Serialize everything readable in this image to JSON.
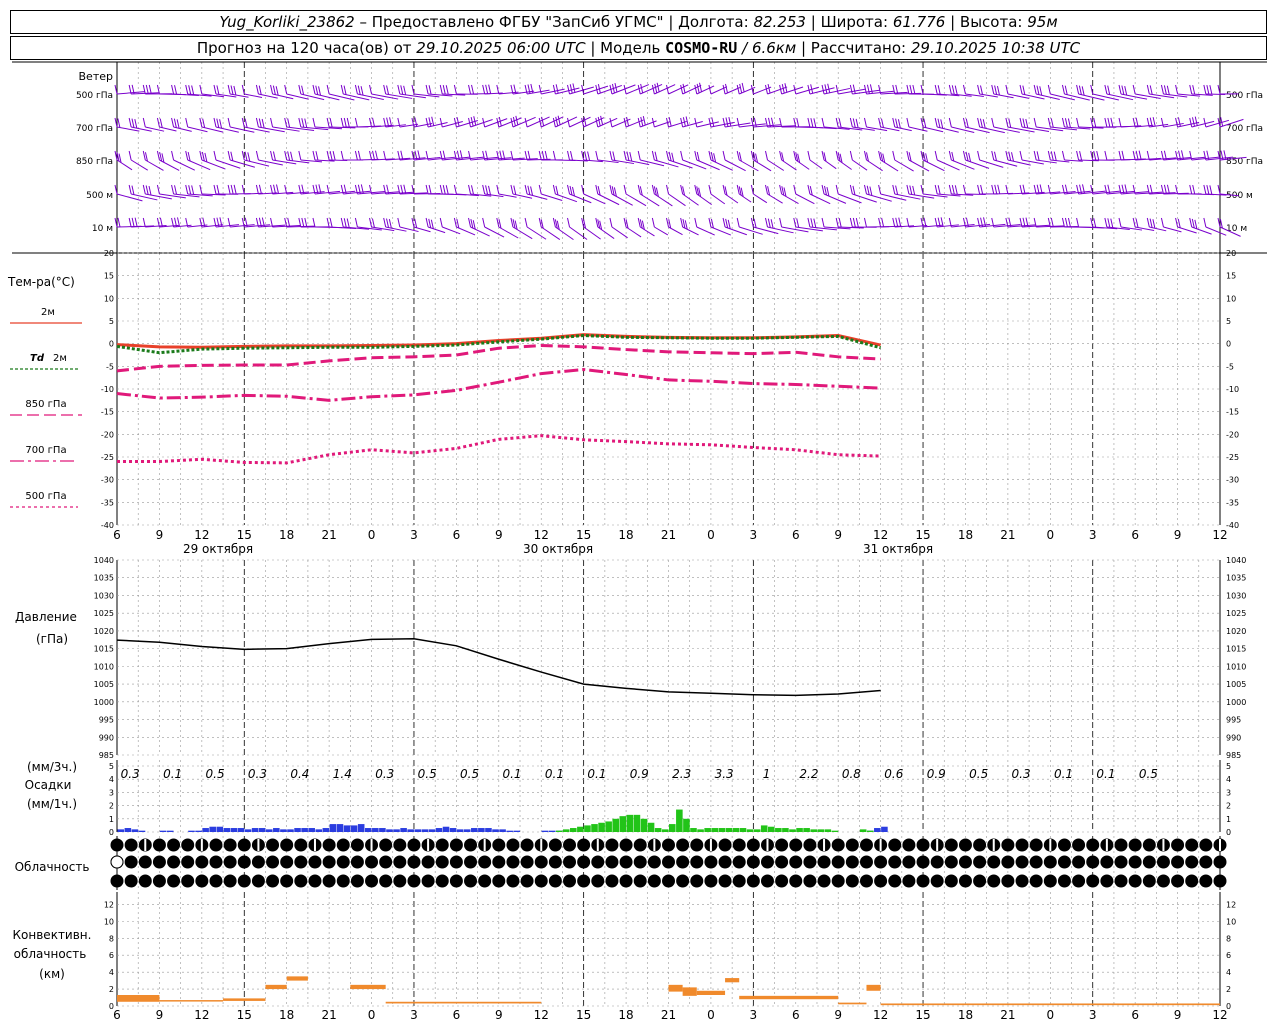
{
  "header": {
    "station": "Yug_Korliki_23862",
    "provider": "– Предоставлено ФГБУ \"ЗапСиб УГМС\"",
    "lon_label": "Долгота:",
    "lon": "82.253",
    "lat_label": "Широта:",
    "lat": "61.776",
    "alt_label": "Высота:",
    "alt": "95м",
    "forecast_label": "Прогноз на 120 часа(ов) от",
    "forecast_time": "29.10.2025 06:00 UTC",
    "model_label": "Модель",
    "model": "COSMO-RU",
    "resolution": "/ 6.6км",
    "calc_label": "Рассчитано:",
    "calc_time": "29.10.2025 10:38 UTC"
  },
  "chart_data": [
    {
      "type": "wind-barbs",
      "title": "Ветер",
      "levels": [
        "500 гПа",
        "700 гПа",
        "850 гПа",
        "500 м",
        "10 м"
      ],
      "color": "#7a00cc"
    },
    {
      "type": "line",
      "title": "Тем-ра(°C)",
      "ylim": [
        -40,
        20
      ],
      "yticks": [
        20,
        15,
        10,
        5,
        0,
        -5,
        -10,
        -15,
        -20,
        -25,
        -30,
        -35,
        -40
      ],
      "x_hours": [
        0,
        6,
        12,
        18,
        24,
        30,
        36,
        42,
        48,
        54,
        60,
        66,
        72,
        78,
        84,
        90,
        96,
        102,
        108
      ],
      "series": [
        {
          "name": "2м",
          "color": "#e8402a",
          "dash": "",
          "values": [
            -0.2,
            -0.7,
            -0.8,
            -0.6,
            -0.5,
            -0.5,
            -0.4,
            -0.3,
            0.0,
            0.7,
            1.2,
            2.0,
            1.6,
            1.4,
            1.3,
            1.3,
            1.5,
            1.8,
            -0.3
          ]
        },
        {
          "name": "Td 2м",
          "color": "#1a7a1a",
          "dash": "3,2",
          "values": [
            -0.6,
            -2.0,
            -1.2,
            -1.0,
            -0.9,
            -0.8,
            -0.8,
            -0.6,
            -0.3,
            0.4,
            1.0,
            1.8,
            1.4,
            1.3,
            1.2,
            1.2,
            1.4,
            1.6,
            -0.9
          ]
        },
        {
          "name": "850 гПа",
          "color": "#e0197a",
          "dash": "12,5",
          "values": [
            -6.0,
            -5.0,
            -4.8,
            -4.7,
            -4.7,
            -3.8,
            -3.1,
            -2.9,
            -2.5,
            -1.0,
            -0.4,
            -0.7,
            -1.3,
            -1.8,
            -2.0,
            -2.2,
            -1.9,
            -2.9,
            -3.4
          ]
        },
        {
          "name": "700 гПа",
          "color": "#e0197a",
          "dash": "14,4,3,4",
          "values": [
            -11.0,
            -12.0,
            -11.8,
            -11.4,
            -11.6,
            -12.5,
            -11.7,
            -11.3,
            -10.3,
            -8.5,
            -6.6,
            -5.7,
            -6.8,
            -8.0,
            -8.3,
            -8.8,
            -9.0,
            -9.4,
            -9.8
          ]
        },
        {
          "name": "500 гПа",
          "color": "#e0197a",
          "dash": "3,3",
          "values": [
            -26.0,
            -26.0,
            -25.5,
            -26.2,
            -26.3,
            -24.5,
            -23.4,
            -24.1,
            -23.1,
            -21.1,
            -20.3,
            -21.2,
            -21.6,
            -22.1,
            -22.3,
            -22.9,
            -23.4,
            -24.5,
            -24.8
          ]
        }
      ]
    },
    {
      "type": "line",
      "title": "Давление",
      "ylabel": "(гПа)",
      "ylim": [
        985,
        1040
      ],
      "yticks": [
        1040,
        1035,
        1030,
        1025,
        1020,
        1015,
        1010,
        1005,
        1000,
        995,
        990,
        985
      ],
      "x_hours": [
        0,
        6,
        12,
        18,
        24,
        30,
        36,
        42,
        48,
        54,
        60,
        66,
        72,
        78,
        84,
        90,
        96,
        102,
        108
      ],
      "series": [
        {
          "name": "",
          "color": "#000000",
          "values": [
            1017.4,
            1016.8,
            1015.6,
            1014.8,
            1015.0,
            1016.4,
            1017.6,
            1017.8,
            1015.8,
            1012.0,
            1008.4,
            1005.0,
            1003.8,
            1002.8,
            1002.4,
            1002.0,
            1001.8,
            1002.2,
            1003.2
          ]
        }
      ]
    },
    {
      "type": "bar",
      "title": "Осадки",
      "ylabel_top": "(мм/3ч.)",
      "ylabel_bottom": "(мм/1ч.)",
      "ylim": [
        0,
        5
      ],
      "yticks": [
        5,
        4,
        3,
        2,
        1,
        0
      ],
      "totals_3h": [
        "0.3",
        "0.1",
        "0.5",
        "0.3",
        "0.4",
        "1.4",
        "0.3",
        "0.5",
        "0.5",
        "0.1",
        "0.1",
        "0.1",
        "0.9",
        "2.3",
        "3.3",
        "1",
        "2.2",
        "0.8",
        "0.6",
        "0.9",
        "0.5",
        "0.3",
        "0.1",
        "0.1",
        "0.5"
      ],
      "hourly_series": [
        {
          "name": "snow",
          "color": "#2b3de0",
          "values": [
            0.2,
            0.3,
            0.2,
            0.1,
            0.0,
            0.0,
            0.1,
            0.1,
            0.0,
            0.0,
            0.1,
            0.1,
            0.3,
            0.4,
            0.4,
            0.3,
            0.3,
            0.3,
            0.2,
            0.3,
            0.3,
            0.2,
            0.3,
            0.2,
            0.2,
            0.3,
            0.3,
            0.3,
            0.2,
            0.3,
            0.6,
            0.6,
            0.5,
            0.5,
            0.6,
            0.3,
            0.3,
            0.3,
            0.2,
            0.2,
            0.3,
            0.2,
            0.2,
            0.2,
            0.2,
            0.3,
            0.4,
            0.3,
            0.2,
            0.2,
            0.3,
            0.3,
            0.3,
            0.2,
            0.2,
            0.1,
            0.1,
            0.0,
            0.0,
            0.0,
            0.1,
            0.1,
            0.1,
            0.0,
            0.0,
            0.0,
            0.0,
            0.0,
            0.0,
            0.0,
            0.0,
            0.0,
            0.0,
            0.0,
            0.0,
            0.0,
            0.0,
            0.0,
            0.0,
            0.0,
            0.0,
            0.0,
            0.0,
            0.0,
            0.0,
            0.0,
            0.0,
            0.0,
            0.0,
            0.0,
            0.0,
            0.0,
            0.0,
            0.0,
            0.0,
            0.0,
            0.0,
            0.0,
            0.0,
            0.0,
            0.0,
            0.0,
            0.0,
            0.0,
            0.0,
            0.0,
            0.1,
            0.3,
            0.4
          ]
        },
        {
          "name": "rain",
          "color": "#22c418",
          "values": [
            0.0,
            0.0,
            0.0,
            0.0,
            0.0,
            0.0,
            0.0,
            0.0,
            0.0,
            0.0,
            0.0,
            0.0,
            0.0,
            0.0,
            0.0,
            0.0,
            0.0,
            0.0,
            0.0,
            0.0,
            0.0,
            0.0,
            0.0,
            0.0,
            0.0,
            0.0,
            0.0,
            0.0,
            0.0,
            0.0,
            0.0,
            0.0,
            0.0,
            0.0,
            0.0,
            0.0,
            0.0,
            0.0,
            0.0,
            0.0,
            0.0,
            0.0,
            0.0,
            0.0,
            0.0,
            0.0,
            0.0,
            0.0,
            0.0,
            0.0,
            0.0,
            0.0,
            0.0,
            0.0,
            0.0,
            0.0,
            0.0,
            0.0,
            0.0,
            0.0,
            0.0,
            0.0,
            0.1,
            0.2,
            0.3,
            0.4,
            0.5,
            0.6,
            0.7,
            0.8,
            1.0,
            1.2,
            1.3,
            1.3,
            1.0,
            0.7,
            0.3,
            0.2,
            0.6,
            1.7,
            1.0,
            0.3,
            0.2,
            0.3,
            0.3,
            0.3,
            0.3,
            0.3,
            0.3,
            0.2,
            0.2,
            0.5,
            0.4,
            0.3,
            0.3,
            0.2,
            0.3,
            0.3,
            0.2,
            0.2,
            0.2,
            0.1,
            0.0,
            0.0,
            0.0,
            0.2,
            0.1,
            0.0,
            0.0
          ]
        }
      ]
    },
    {
      "type": "table",
      "title": "Облачность",
      "rows": 3,
      "symbol": "cloud-cover-circles"
    },
    {
      "type": "bar",
      "title": "Конвективн. облачность",
      "ylabel": "(км)",
      "ylim": [
        0,
        13
      ],
      "yticks": [
        12,
        10,
        8,
        6,
        4,
        2,
        0
      ],
      "color": "#f08a2c",
      "bars": [
        {
          "h0": 0,
          "h1": 6,
          "bottom": 0.5,
          "top": 1.3
        },
        {
          "h0": 6,
          "h1": 15,
          "bottom": 0.6,
          "top": 0.7
        },
        {
          "h0": 15,
          "h1": 21,
          "bottom": 0.6,
          "top": 0.9
        },
        {
          "h0": 21,
          "h1": 24,
          "bottom": 2.0,
          "top": 2.5
        },
        {
          "h0": 24,
          "h1": 27,
          "bottom": 3.0,
          "top": 3.5
        },
        {
          "h0": 33,
          "h1": 38,
          "bottom": 2.0,
          "top": 2.5
        },
        {
          "h0": 38,
          "h1": 60,
          "bottom": 0.3,
          "top": 0.5
        },
        {
          "h0": 78,
          "h1": 80,
          "bottom": 1.7,
          "top": 2.5
        },
        {
          "h0": 80,
          "h1": 82,
          "bottom": 1.2,
          "top": 2.2
        },
        {
          "h0": 82,
          "h1": 86,
          "bottom": 1.3,
          "top": 1.8
        },
        {
          "h0": 86,
          "h1": 88,
          "bottom": 2.8,
          "top": 3.3
        },
        {
          "h0": 88,
          "h1": 102,
          "bottom": 0.8,
          "top": 1.2
        },
        {
          "h0": 102,
          "h1": 106,
          "bottom": 0.2,
          "top": 0.4
        },
        {
          "h0": 106,
          "h1": 108,
          "bottom": 1.8,
          "top": 2.5
        },
        {
          "h0": 108,
          "h1": 156,
          "bottom": 0.1,
          "top": 0.3
        }
      ]
    }
  ],
  "time_axis": {
    "hour_labels": [
      "6",
      "9",
      "12",
      "15",
      "18",
      "21",
      "0",
      "3",
      "6",
      "9",
      "12",
      "15",
      "18",
      "21",
      "0",
      "3",
      "6",
      "9",
      "12",
      "15",
      "18",
      "21",
      "0",
      "3",
      "6",
      "9",
      "12"
    ],
    "dates": [
      "29 октября",
      "30 октября",
      "31 октября"
    ]
  },
  "legend": {
    "t2m": "2м",
    "td_prefix": "Td",
    "td_suffix": "2м",
    "t850": "850 гПа",
    "t700": "700 гПа",
    "t500": "500 гПа"
  }
}
